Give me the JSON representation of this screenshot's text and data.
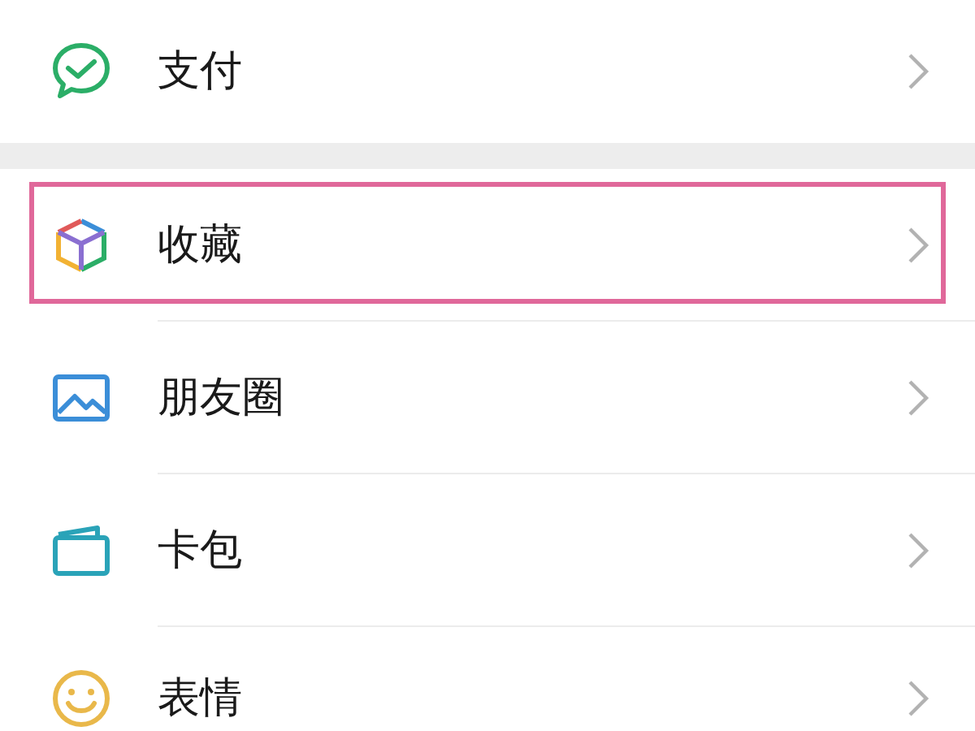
{
  "menu_groups": [
    {
      "items": [
        {
          "label": "支付",
          "highlighted": false
        }
      ]
    },
    {
      "items": [
        {
          "label": "收藏",
          "highlighted": true
        },
        {
          "label": "朋友圈",
          "highlighted": false
        },
        {
          "label": "卡包",
          "highlighted": false
        },
        {
          "label": "表情",
          "highlighted": false
        }
      ]
    }
  ]
}
